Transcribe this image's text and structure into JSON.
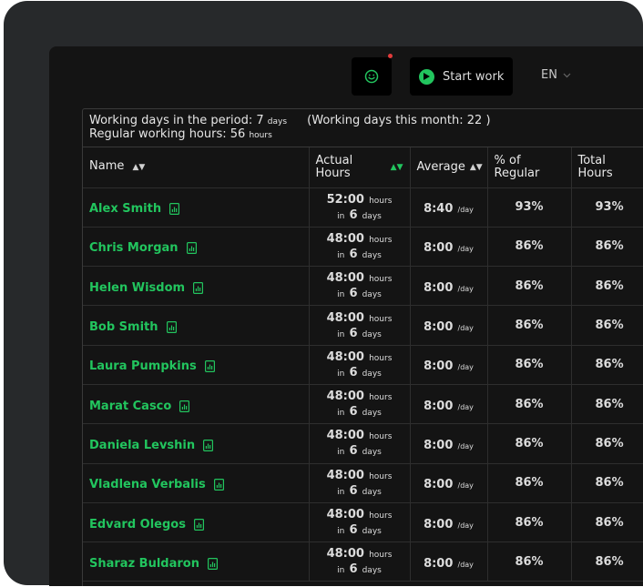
{
  "header": {
    "start_label": "Start work",
    "language": "EN",
    "icons": {
      "mood": "smiley-icon",
      "play": "play-icon",
      "chevron": "chevron-down-icon"
    },
    "colors": {
      "accent": "#22c55e",
      "notification": "#e23b3b"
    }
  },
  "summary": {
    "working_days_label": "Working days in the period:",
    "working_days_value": "7",
    "working_days_unit": "days",
    "month_text": "(Working days this month: 22 )",
    "regular_hours_label": "Regular working hours:",
    "regular_hours_value": "56",
    "regular_hours_unit": "hours"
  },
  "table": {
    "columns": {
      "name": "Name",
      "actual_line1": "Actual",
      "actual_line2": "Hours",
      "average": "Average",
      "pct_line1": "% of",
      "pct_line2": "Regular",
      "total_line1": "Total",
      "total_line2": "Hours"
    },
    "rows": [
      {
        "name": "Alex Smith",
        "actual": "52:00",
        "days": "6",
        "avg": "8:40",
        "pct": "93%",
        "total": "93%"
      },
      {
        "name": "Chris Morgan",
        "actual": "48:00",
        "days": "6",
        "avg": "8:00",
        "pct": "86%",
        "total": "86%"
      },
      {
        "name": "Helen Wisdom",
        "actual": "48:00",
        "days": "6",
        "avg": "8:00",
        "pct": "86%",
        "total": "86%"
      },
      {
        "name": "Bob Smith",
        "actual": "48:00",
        "days": "6",
        "avg": "8:00",
        "pct": "86%",
        "total": "86%"
      },
      {
        "name": "Laura Pumpkins",
        "actual": "48:00",
        "days": "6",
        "avg": "8:00",
        "pct": "86%",
        "total": "86%"
      },
      {
        "name": "Marat Casco",
        "actual": "48:00",
        "days": "6",
        "avg": "8:00",
        "pct": "86%",
        "total": "86%"
      },
      {
        "name": "Daniela Levshin",
        "actual": "48:00",
        "days": "6",
        "avg": "8:00",
        "pct": "86%",
        "total": "86%"
      },
      {
        "name": "Vladlena Verbalis",
        "actual": "48:00",
        "days": "6",
        "avg": "8:00",
        "pct": "86%",
        "total": "86%"
      },
      {
        "name": "Edvard Olegos",
        "actual": "48:00",
        "days": "6",
        "avg": "8:00",
        "pct": "86%",
        "total": "86%"
      },
      {
        "name": "Sharaz Buldaron",
        "actual": "48:00",
        "days": "6",
        "avg": "8:00",
        "pct": "86%",
        "total": "86%"
      }
    ],
    "units": {
      "hours": "hours",
      "in": "in",
      "days": "days",
      "per_day": "/day"
    }
  }
}
